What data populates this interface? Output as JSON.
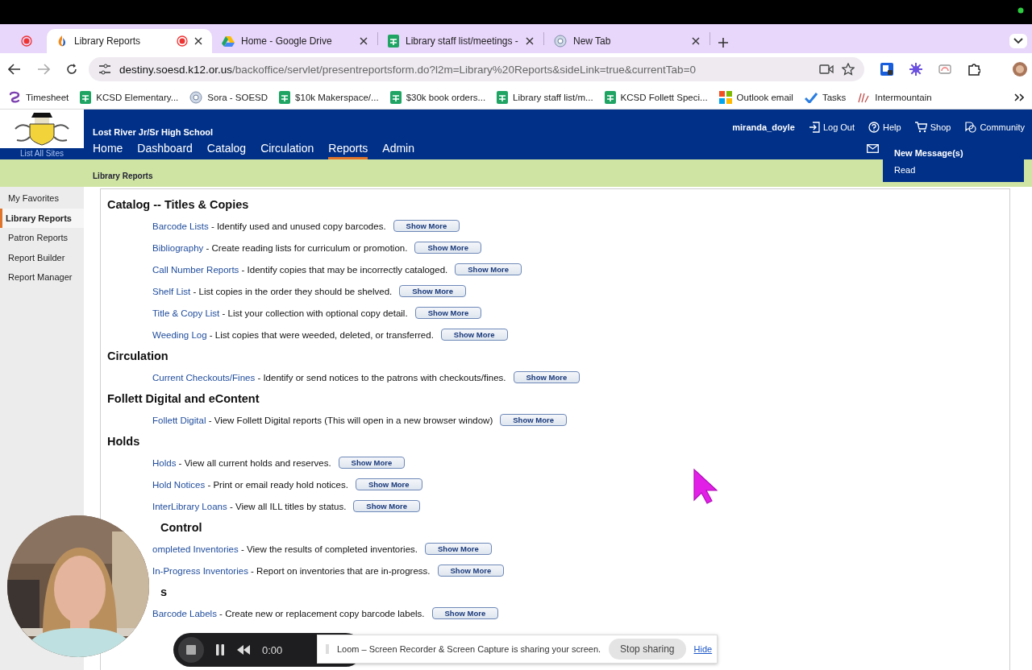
{
  "browser": {
    "tabs": [
      {
        "kind": "pinned",
        "recording": true,
        "selected": false
      },
      {
        "kind": "flame",
        "title": "Library Reports",
        "recording": true,
        "selected": true
      },
      {
        "kind": "triangle",
        "title": "Home - Google Drive",
        "recording": false,
        "selected": false
      },
      {
        "kind": "sheet",
        "title": "Library staff list/meetings -",
        "recording": false,
        "selected": false
      },
      {
        "kind": "ring",
        "title": "New Tab",
        "recording": false,
        "selected": false
      }
    ],
    "url": {
      "host": "destiny.soesd.k12.or.us",
      "path": "/backoffice/servlet/presentreportsform.do?l2m=Library%20Reports&sideLink=true&currentTab=0"
    },
    "bookmarks": [
      {
        "label": "Timesheet",
        "kind": "loop"
      },
      {
        "label": "KCSD Elementary...",
        "kind": "sheet"
      },
      {
        "label": "Sora - SOESD",
        "kind": "ring"
      },
      {
        "label": "$10k Makerspace/...",
        "kind": "sheet"
      },
      {
        "label": "$30k book orders...",
        "kind": "sheet"
      },
      {
        "label": "Library staff list/m...",
        "kind": "sheet"
      },
      {
        "label": "KCSD Follett Speci...",
        "kind": "sheet"
      },
      {
        "label": "Outlook email",
        "kind": "grid"
      },
      {
        "label": "Tasks",
        "kind": "check"
      },
      {
        "label": "Intermountain",
        "kind": "lines"
      }
    ]
  },
  "app": {
    "logo_link": "List All Sites",
    "school": "Lost River Jr/Sr High School",
    "user": "miranda_doyle",
    "utilities": [
      {
        "label": "Log Out",
        "kind": "logout"
      },
      {
        "label": "Help",
        "kind": "help"
      },
      {
        "label": "Shop",
        "kind": "cart"
      },
      {
        "label": "Community",
        "kind": "chat"
      }
    ],
    "nav": [
      {
        "label": "Home",
        "selected": false
      },
      {
        "label": "Dashboard",
        "selected": false
      },
      {
        "label": "Catalog",
        "selected": false
      },
      {
        "label": "Circulation",
        "selected": false
      },
      {
        "label": "Reports",
        "selected": true
      },
      {
        "label": "Admin",
        "selected": false
      }
    ],
    "messages": {
      "title": "New Message(s)",
      "action": "Read"
    },
    "breadcrumb": "Library Reports"
  },
  "sidebar": [
    {
      "label": "My Favorites",
      "selected": false
    },
    {
      "label": "Library Reports",
      "selected": true
    },
    {
      "label": "Patron Reports",
      "selected": false
    },
    {
      "label": "Report Builder",
      "selected": false
    },
    {
      "label": "Report Manager",
      "selected": false
    }
  ],
  "sections": [
    {
      "title": "Catalog -- Titles & Copies",
      "obscured": false,
      "reports": [
        {
          "name": "Barcode Lists",
          "description": "- Identify used and unused copy barcodes.",
          "button": "Show More"
        },
        {
          "name": "Bibliography",
          "description": "- Create reading lists for curriculum or promotion.",
          "button": "Show More"
        },
        {
          "name": "Call Number Reports",
          "description": "- Identify copies that may be incorrectly cataloged.",
          "button": "Show More"
        },
        {
          "name": "Shelf List",
          "description": "- List copies in the order they should be shelved.",
          "button": "Show More"
        },
        {
          "name": "Title & Copy List",
          "description": "- List your collection with optional copy detail.",
          "button": "Show More"
        },
        {
          "name": "Weeding Log",
          "description": "- List copies that were weeded, deleted, or transferred.",
          "button": "Show More"
        }
      ]
    },
    {
      "title": "Circulation",
      "obscured": false,
      "reports": [
        {
          "name": "Current Checkouts/Fines",
          "description": "- Identify or send notices to the patrons with checkouts/fines.",
          "button": "Show More"
        }
      ]
    },
    {
      "title": "Follett Digital and eContent",
      "obscured": false,
      "reports": [
        {
          "name": "Follett Digital",
          "description": "- View Follett Digital reports (This will open in a new browser window)",
          "button": "Show More"
        }
      ]
    },
    {
      "title": "Holds",
      "obscured": false,
      "reports": [
        {
          "name": "Holds",
          "description": "- View all current holds and reserves.",
          "button": "Show More"
        },
        {
          "name": "Hold Notices",
          "description": "- Print or email ready hold notices.",
          "button": "Show More"
        },
        {
          "name": "InterLibrary Loans",
          "description": "- View all ILL titles by status.",
          "button": "Show More"
        }
      ]
    },
    {
      "title": "Control",
      "obscured": true,
      "reports": [
        {
          "name": "ompleted Inventories",
          "description": "- View the results of completed inventories.",
          "button": "Show More"
        },
        {
          "name": "In-Progress Inventories",
          "description": "- Report on inventories that are in-progress.",
          "button": "Show More"
        }
      ]
    },
    {
      "title": "s",
      "obscured": true,
      "reports": [
        {
          "name": "Barcode Labels",
          "description": "- Create new or replacement copy barcode labels.",
          "button": "Show More"
        }
      ]
    }
  ],
  "loom": {
    "time": "0:00",
    "banner": "Loom – Screen Recorder & Screen Capture is sharing your screen.",
    "stop": "Stop sharing",
    "hide": "Hide"
  }
}
